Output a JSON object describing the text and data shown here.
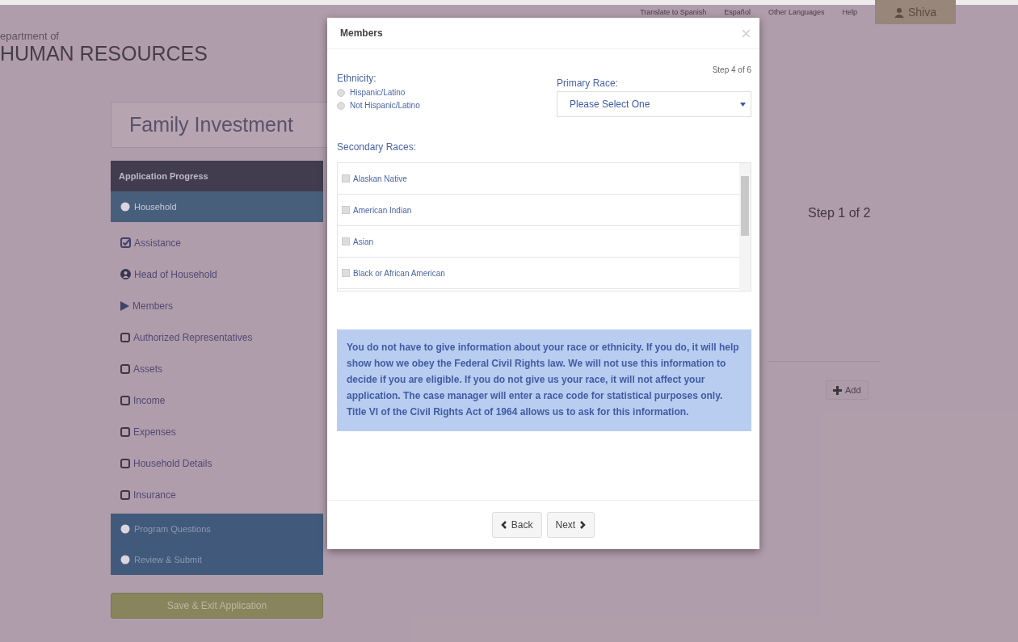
{
  "top_nav": {
    "links": [
      "Translate to Spanish",
      "Español",
      "Other Languages",
      "Help"
    ],
    "user": "Shiva"
  },
  "header": {
    "prefix": "epartment of",
    "title": "HUMAN RESOURCES"
  },
  "page_title": "Family Investment",
  "sidebar": {
    "heading": "Application Progress",
    "sections": [
      {
        "label": "Household",
        "selected": true,
        "items": [
          {
            "label": "Assistance",
            "kind": "check"
          },
          {
            "label": "Head of Household",
            "kind": "person"
          },
          {
            "label": "Members",
            "kind": "arrow"
          },
          {
            "label": "Authorized Representatives",
            "kind": "box"
          },
          {
            "label": "Assets",
            "kind": "box"
          },
          {
            "label": "Income",
            "kind": "box"
          },
          {
            "label": "Expenses",
            "kind": "box"
          },
          {
            "label": "Household Details",
            "kind": "box"
          },
          {
            "label": "Insurance",
            "kind": "box"
          }
        ]
      },
      {
        "label": "Program Questions",
        "selected": false
      },
      {
        "label": "Review & Submit",
        "selected": false
      }
    ],
    "save_button": "Save & Exit Application"
  },
  "main": {
    "step": "Step 1 of 2",
    "add_button": "Add"
  },
  "modal": {
    "title": "Members",
    "step": "Step 4 of 6",
    "ethnicity": {
      "label": "Ethnicity:",
      "options": [
        {
          "label": "Hispanic/Latino",
          "selected": false
        },
        {
          "label": "Not Hispanic/Latino",
          "selected": false
        }
      ]
    },
    "primary_race": {
      "label": "Primary Race:",
      "placeholder": "Please Select One"
    },
    "secondary_races": {
      "label": "Secondary Races:",
      "options": [
        {
          "label": "Alaskan Native",
          "checked": false
        },
        {
          "label": "American Indian",
          "checked": false
        },
        {
          "label": "Asian",
          "checked": false
        },
        {
          "label": "Black or African American",
          "checked": false
        }
      ]
    },
    "notice": "You do not have to give information about your race or ethnicity. If you do, it will help show how we obey the Federal Civil Rights law. We will not use this information to decide if you are eligible. If you do not give us your race, it will not affect your application. The case manager will enter a race code for statistical purposes only. Title VI of the Civil Rights Act of 1964 allows us to ask for this information.",
    "buttons": {
      "back": "Back",
      "next": "Next"
    }
  }
}
